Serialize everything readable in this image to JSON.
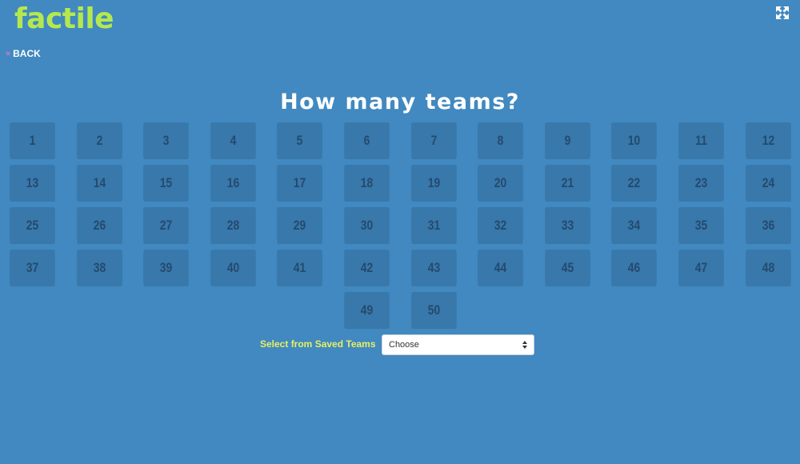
{
  "header": {
    "logo_text": "factile",
    "fullscreen_icon": "expand-arrows-icon"
  },
  "nav": {
    "back_chevron": "«",
    "back_label": "BACK"
  },
  "main": {
    "title": "How many teams?",
    "team_options": [
      "1",
      "2",
      "3",
      "4",
      "5",
      "6",
      "7",
      "8",
      "9",
      "10",
      "11",
      "12",
      "13",
      "14",
      "15",
      "16",
      "17",
      "18",
      "19",
      "20",
      "21",
      "22",
      "23",
      "24",
      "25",
      "26",
      "27",
      "28",
      "29",
      "30",
      "31",
      "32",
      "33",
      "34",
      "35",
      "36",
      "37",
      "38",
      "39",
      "40",
      "41",
      "42",
      "43",
      "44",
      "45",
      "46",
      "47",
      "48",
      "49",
      "50"
    ]
  },
  "saved_teams": {
    "label": "Select from Saved Teams",
    "selected": "Choose"
  },
  "colors": {
    "background": "#4189c0",
    "button": "#3878ab",
    "button_text": "#254a6e",
    "logo": "#b5e84f",
    "label": "#e8ef64"
  }
}
